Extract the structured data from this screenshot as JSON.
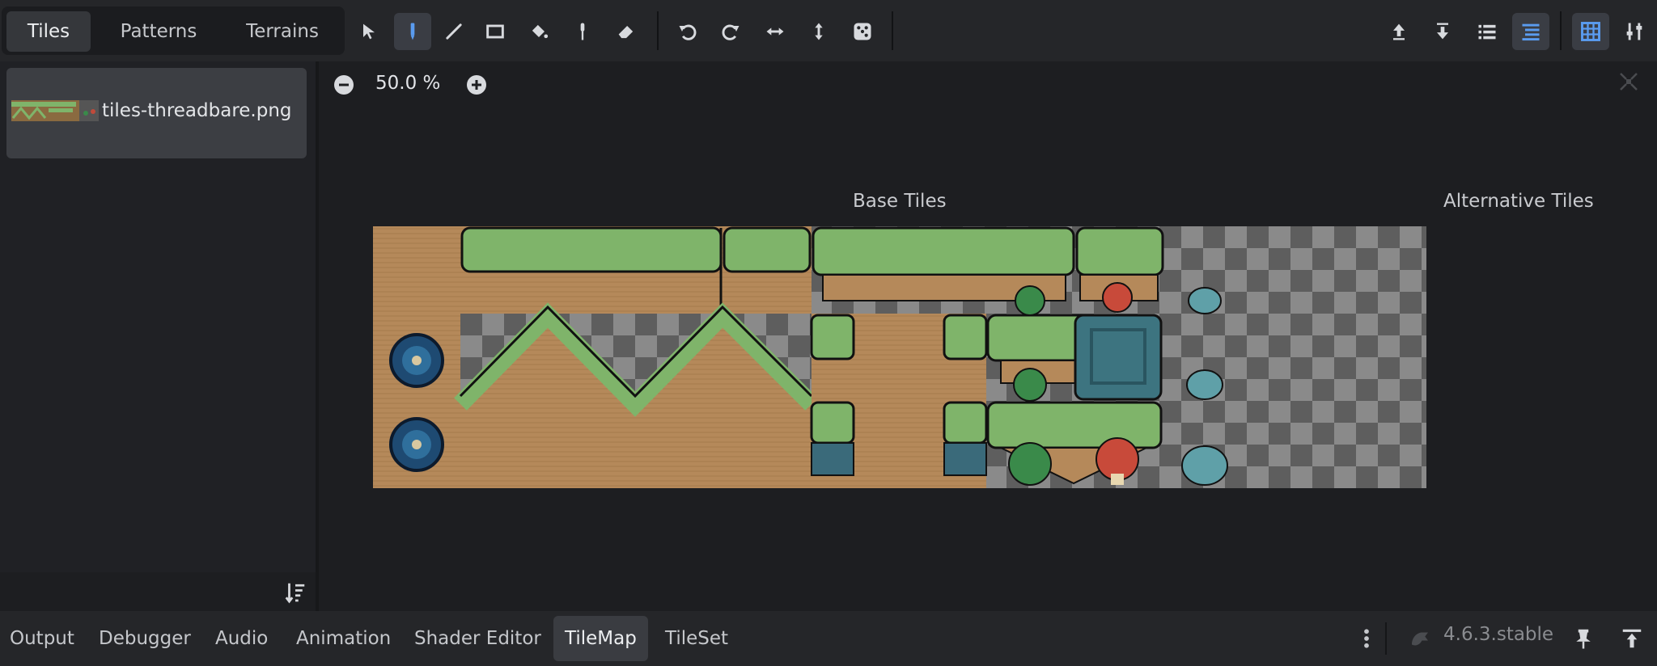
{
  "top_tabs": [
    {
      "label": "Tiles",
      "active": true
    },
    {
      "label": "Patterns",
      "active": false
    },
    {
      "label": "Terrains",
      "active": false
    }
  ],
  "toolbar": {
    "tools": [
      "select-icon",
      "paint-icon",
      "line-icon",
      "rect-icon",
      "bucket-icon",
      "picker-icon",
      "eraser-icon",
      "rotate-left-icon",
      "rotate-right-icon",
      "flip-h-icon",
      "flip-v-icon",
      "random-icon"
    ],
    "active_tool": "paint-icon",
    "right_tools": [
      "move-up-icon",
      "move-down-icon",
      "list-icon",
      "layer-list-icon",
      "grid-icon",
      "tools-settings-icon"
    ]
  },
  "sources": [
    {
      "name": "tiles-threadbare.png",
      "selected": true
    }
  ],
  "zoom": {
    "value": "50.0 %"
  },
  "atlas": {
    "base_label": "Base Tiles",
    "alt_label": "Alternative Tiles"
  },
  "bottom_tabs": [
    {
      "label": "Output",
      "active": false
    },
    {
      "label": "Debugger",
      "active": false
    },
    {
      "label": "Audio",
      "active": false
    },
    {
      "label": "Animation",
      "active": false
    },
    {
      "label": "Shader Editor",
      "active": false
    },
    {
      "label": "TileMap",
      "active": true
    },
    {
      "label": "TileSet",
      "active": false
    }
  ],
  "version": "4.6.3.stable",
  "colors": {
    "accent": "#5a9cf0",
    "grass": "#7fb46a",
    "dirt": "#b08a55",
    "water": "#3a6a8a"
  }
}
